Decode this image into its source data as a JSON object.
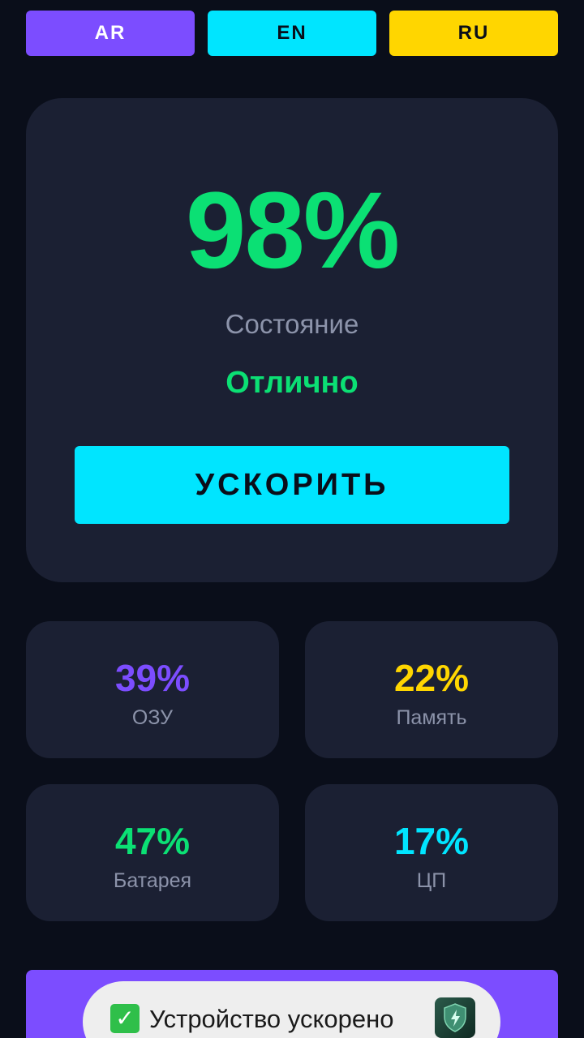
{
  "languages": [
    {
      "label": "AR",
      "color": "#7c4dff"
    },
    {
      "label": "EN",
      "color": "#00e5ff"
    },
    {
      "label": "RU",
      "color": "#ffd600"
    }
  ],
  "main": {
    "score": "98%",
    "score_color": "#0be074",
    "state_label": "Состояние",
    "state_value": "Отлично",
    "state_color": "#0be074",
    "boost_label": "УСКОРИТЬ",
    "boost_color": "#00e5ff"
  },
  "stats": [
    {
      "value": "39%",
      "label": "ОЗУ",
      "color": "#7c4dff"
    },
    {
      "value": "22%",
      "label": "Память",
      "color": "#ffd600"
    },
    {
      "value": "47%",
      "label": "Батарея",
      "color": "#0be074"
    },
    {
      "value": "17%",
      "label": "ЦП",
      "color": "#00e5ff"
    }
  ],
  "bottom_bar": {
    "color": "#7c4dff"
  },
  "toast": {
    "icon": "check-mark-icon",
    "text": "Устройство ускорено",
    "app_icon": "shield-bolt-icon"
  }
}
